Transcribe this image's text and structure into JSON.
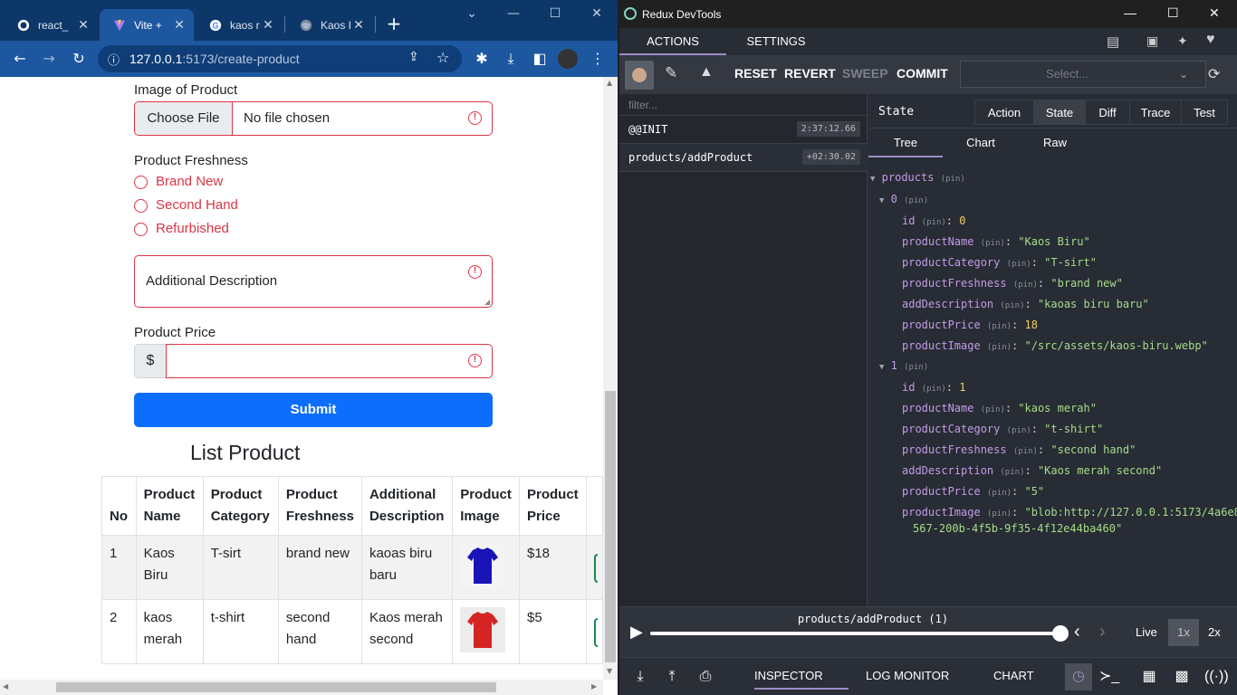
{
  "browser": {
    "tabs": [
      {
        "label": "react_",
        "icon": "github-icon"
      },
      {
        "label": "Vite +",
        "icon": "vite-icon"
      },
      {
        "label": "kaos r",
        "icon": "google-icon"
      },
      {
        "label": "Kaos I",
        "icon": "globe-icon"
      }
    ],
    "new_tab": "+",
    "url_host": "127.0.0.1",
    "url_rest": ":5173/create-product"
  },
  "form": {
    "image_label": "Image of Product",
    "choose_file": "Choose File",
    "no_file": "No file chosen",
    "freshness_label": "Product Freshness",
    "freshness_options": [
      "Brand New",
      "Second Hand",
      "Refurbished"
    ],
    "description_placeholder": "Additional Description",
    "price_label": "Product Price",
    "currency": "$",
    "submit": "Submit"
  },
  "list": {
    "title": "List Product",
    "headers": [
      "No",
      "Product Name",
      "Product Category",
      "Product Freshness",
      "Additional Description",
      "Product Image",
      "Product Price"
    ],
    "rows": [
      {
        "no": "1",
        "name": "Kaos Biru",
        "category": "T-sirt",
        "freshness": "brand new",
        "description": "kaoas biru baru",
        "image_color": "#1a14b8",
        "price": "$18"
      },
      {
        "no": "2",
        "name": "kaos merah",
        "category": "t-shirt",
        "freshness": "second hand",
        "description": "Kaos merah second",
        "image_color": "#d42424",
        "price": "$5"
      }
    ]
  },
  "devtools": {
    "window_title": "Redux DevTools",
    "tabs": [
      "ACTIONS",
      "SETTINGS"
    ],
    "buttons": [
      "RESET",
      "REVERT",
      "SWEEP",
      "COMMIT"
    ],
    "select_placeholder": "Select...",
    "filter_placeholder": "filter...",
    "actions": [
      {
        "name": "@@INIT",
        "time": "2:37:12.66"
      },
      {
        "name": "products/addProduct",
        "time": "+02:30.02"
      }
    ],
    "state_label": "State",
    "view_tabs": [
      "Action",
      "State",
      "Diff",
      "Trace",
      "Test"
    ],
    "tree_tabs": [
      "Tree",
      "Chart",
      "Raw"
    ],
    "pin": "(pin)",
    "tree": {
      "root": "products",
      "items": [
        {
          "index": "0",
          "fields": [
            {
              "key": "id",
              "value": "0",
              "type": "num"
            },
            {
              "key": "productName",
              "value": "\"Kaos Biru\"",
              "type": "str"
            },
            {
              "key": "productCategory",
              "value": "\"T-sirt\"",
              "type": "str"
            },
            {
              "key": "productFreshness",
              "value": "\"brand new\"",
              "type": "str"
            },
            {
              "key": "addDescription",
              "value": "\"kaoas biru baru\"",
              "type": "str"
            },
            {
              "key": "productPrice",
              "value": "18",
              "type": "num"
            },
            {
              "key": "productImage",
              "value": "\"/src/assets/kaos-biru.webp\"",
              "type": "str"
            }
          ]
        },
        {
          "index": "1",
          "fields": [
            {
              "key": "id",
              "value": "1",
              "type": "num"
            },
            {
              "key": "productName",
              "value": "\"kaos merah\"",
              "type": "str"
            },
            {
              "key": "productCategory",
              "value": "\"t-shirt\"",
              "type": "str"
            },
            {
              "key": "productFreshness",
              "value": "\"second hand\"",
              "type": "str"
            },
            {
              "key": "addDescription",
              "value": "\"Kaos merah second\"",
              "type": "str"
            },
            {
              "key": "productPrice",
              "value": "\"5\"",
              "type": "str"
            },
            {
              "key": "productImage",
              "value": "\"blob:http://127.0.0.1:5173/4a6e8",
              "type": "str"
            }
          ]
        }
      ],
      "wrap_line": "567-200b-4f5b-9f35-4f12e44ba460\""
    },
    "slider_title": "products/addProduct (1)",
    "speed": {
      "live": "Live",
      "x1": "1x",
      "x2": "2x"
    },
    "bottom_tabs": [
      "INSPECTOR",
      "LOG MONITOR",
      "CHART"
    ]
  }
}
